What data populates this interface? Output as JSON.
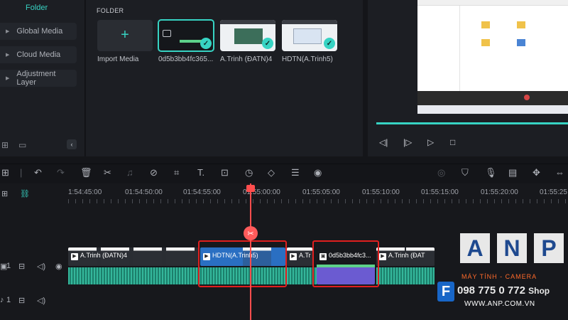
{
  "sidebar": {
    "title": "Folder",
    "items": [
      {
        "label": "Global Media"
      },
      {
        "label": "Cloud Media"
      },
      {
        "label": "Adjustment Layer"
      }
    ]
  },
  "media": {
    "section_title": "FOLDER",
    "import_label": "Import Media",
    "items": [
      {
        "label": "0d5b3bb4fc365..."
      },
      {
        "label": "A.Trinh  (ĐATN)4"
      },
      {
        "label": "HDTN(A.Trinh5)"
      }
    ]
  },
  "timeline": {
    "ruler": [
      "1:54:45:00",
      "01:54:50:00",
      "01:54:55:00",
      "01:55:00:00",
      "01:55:05:00",
      "01:55:10:00",
      "01:55:15:00",
      "01:55:20:00",
      "01:55:25"
    ],
    "clips": [
      {
        "label": "A.Trinh  (ĐATN)4"
      },
      {
        "label": "HDTN(A.Trinh5)"
      },
      {
        "label": "A.Tr"
      },
      {
        "label": "0d5b3bb4fc3..."
      },
      {
        "label": "A.Trinh  (ĐAT"
      }
    ],
    "track_numbers": [
      "1",
      "1"
    ]
  },
  "watermark": {
    "letters": [
      "A",
      "N",
      "P"
    ],
    "subtitle": "MÁY TÍNH - CAMERA",
    "phone": "098 775 0 772",
    "shop": "Shop",
    "website": "WWW.ANP.COM.VN",
    "fpt": "F"
  },
  "colors": {
    "accent": "#37d3c3",
    "playhead": "#ff4d4d",
    "highlight": "#e01f1f",
    "background": "#141519"
  }
}
